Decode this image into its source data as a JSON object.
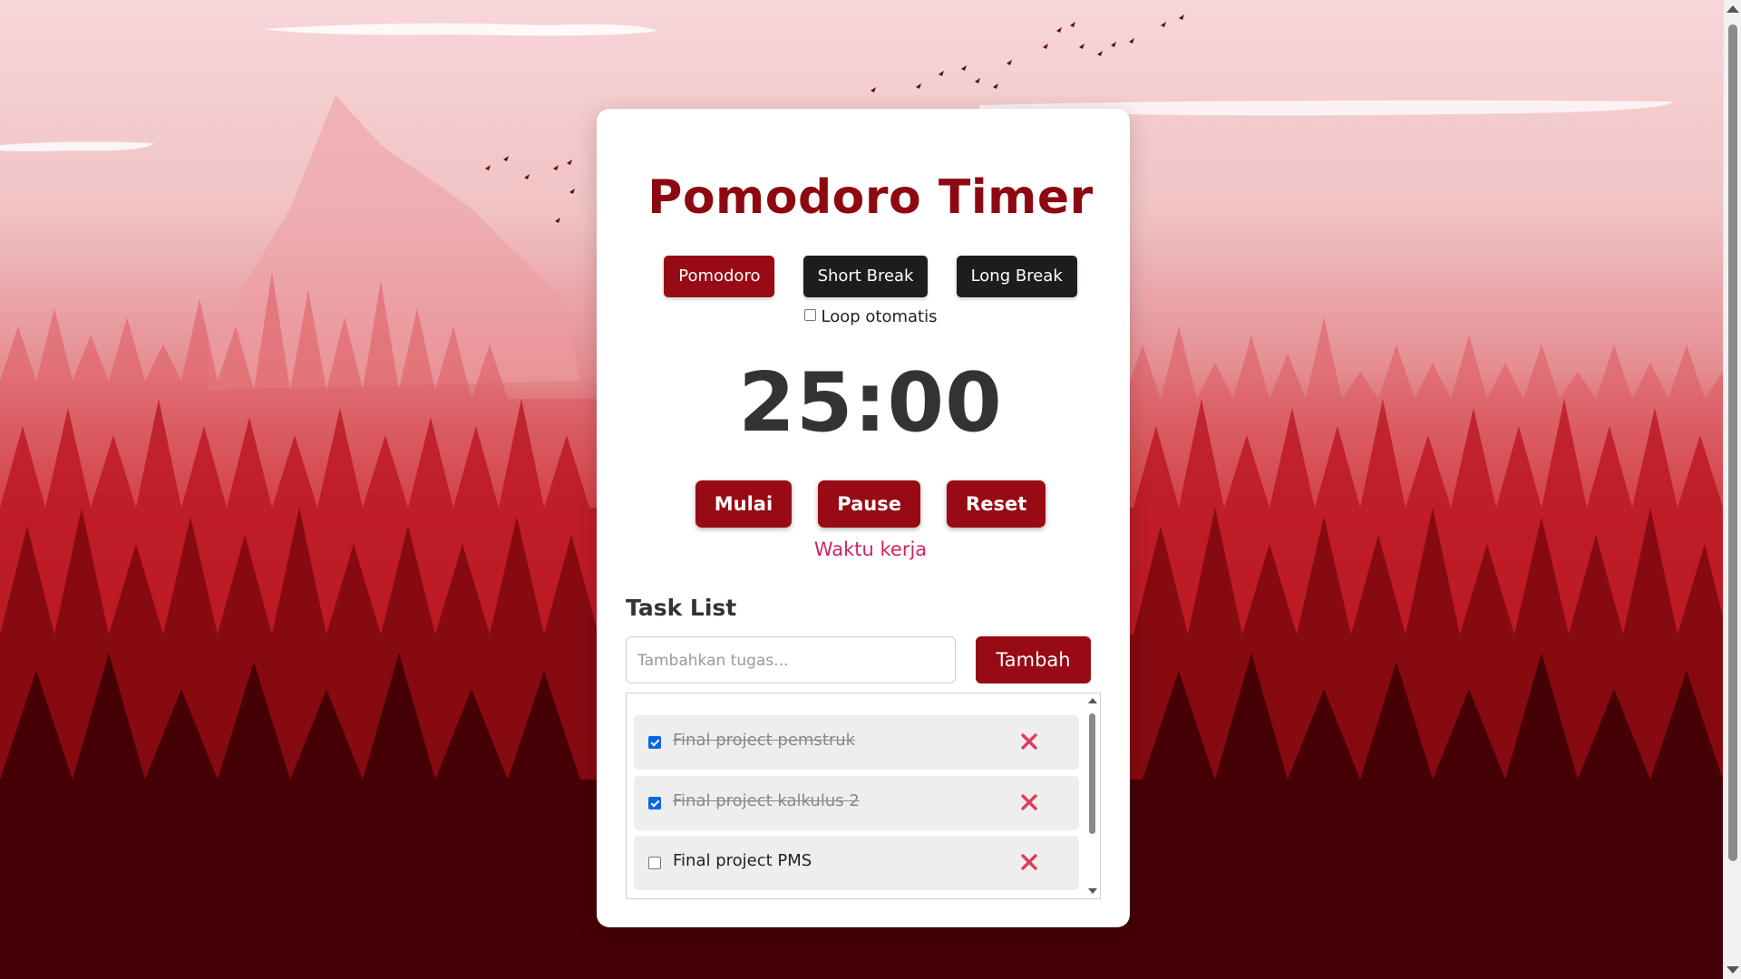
{
  "app": {
    "title": "Pomodoro Timer"
  },
  "modes": [
    {
      "label": "Pomodoro",
      "active": true
    },
    {
      "label": "Short Break",
      "active": false
    },
    {
      "label": "Long Break",
      "active": false
    }
  ],
  "loop": {
    "label": "Loop otomatis",
    "checked": false
  },
  "timer": {
    "display": "25:00"
  },
  "controls": {
    "start_label": "Mulai",
    "pause_label": "Pause",
    "reset_label": "Reset"
  },
  "status": {
    "text": "Waktu kerja"
  },
  "tasks": {
    "heading": "Task List",
    "input_placeholder": "Tambahkan tugas...",
    "add_label": "Tambah",
    "items": [
      {
        "text": "Final project pemstruk",
        "done": true
      },
      {
        "text": "Final project kalkulus 2",
        "done": true
      },
      {
        "text": "Final project PMS",
        "done": false
      }
    ]
  },
  "colors": {
    "accent": "#980a14",
    "title": "#8e0812",
    "dark_button": "#1d1d1d",
    "status_text": "#d3245f",
    "delete_icon": "#e23a5f"
  },
  "icons": {
    "delete": "close-x-icon",
    "checkbox": "checkbox-icon"
  }
}
